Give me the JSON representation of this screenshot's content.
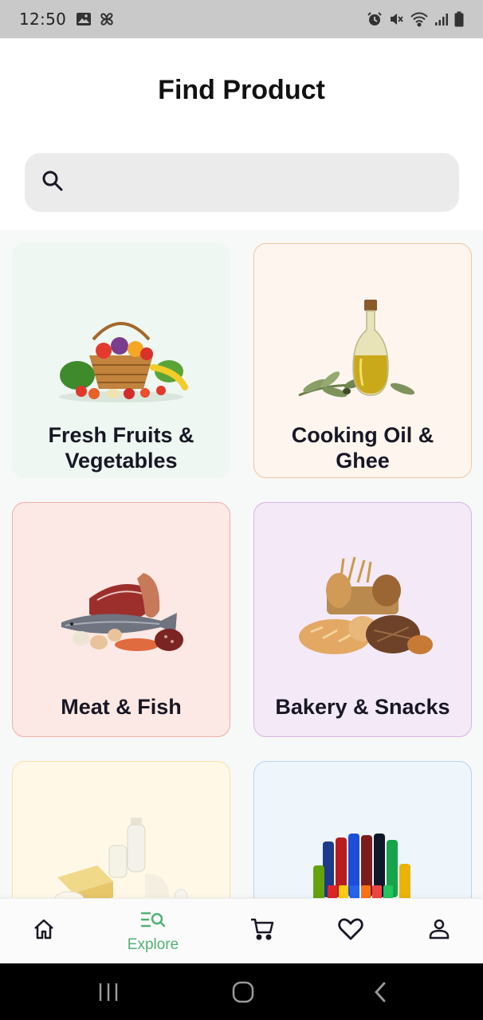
{
  "status_bar": {
    "time": "12:50",
    "left_icons": [
      "gallery-icon",
      "pinwheel-icon"
    ],
    "right_icons": [
      "alarm-icon",
      "mute-icon",
      "wifi-icon",
      "signal-icon",
      "battery-icon"
    ]
  },
  "header": {
    "title": "Find Product"
  },
  "search": {
    "placeholder": "",
    "value": ""
  },
  "categories": [
    {
      "label": "Fresh Fruits & Vegetables",
      "line1": "Fresh Fruits &",
      "line2": "Vegetables",
      "bg": "#eef7f1",
      "border": "#eef7f1",
      "image": "fruit-basket-image"
    },
    {
      "label": "Cooking Oil & Ghee",
      "line1": "Cooking Oil &",
      "line2": "Ghee",
      "bg": "#fdf5ee",
      "border": "#efc7a0",
      "image": "olive-oil-image"
    },
    {
      "label": "Meat & Fish",
      "bg": "#fce8e4",
      "border": "#efb0a6",
      "image": "meat-fish-image"
    },
    {
      "label": "Bakery & Snacks",
      "bg": "#f3e9f7",
      "border": "#d6b3e2",
      "image": "bread-image"
    },
    {
      "label": "",
      "bg": "#fff8e7",
      "border": "#f7e1a6",
      "image": "dairy-image"
    },
    {
      "label": "",
      "bg": "#eef5fb",
      "border": "#b8d6ef",
      "image": "beverages-image"
    }
  ],
  "bottom_nav": {
    "items": [
      {
        "id": "home",
        "label": "",
        "icon": "home-icon"
      },
      {
        "id": "explore",
        "label": "Explore",
        "icon": "explore-icon",
        "active": true
      },
      {
        "id": "cart",
        "label": "",
        "icon": "cart-icon"
      },
      {
        "id": "favourite",
        "label": "",
        "icon": "heart-icon"
      },
      {
        "id": "account",
        "label": "",
        "icon": "user-icon"
      }
    ],
    "active_color": "#53b175"
  },
  "android_nav": {
    "buttons": [
      "recents-icon",
      "home-circle-icon",
      "back-icon"
    ]
  }
}
